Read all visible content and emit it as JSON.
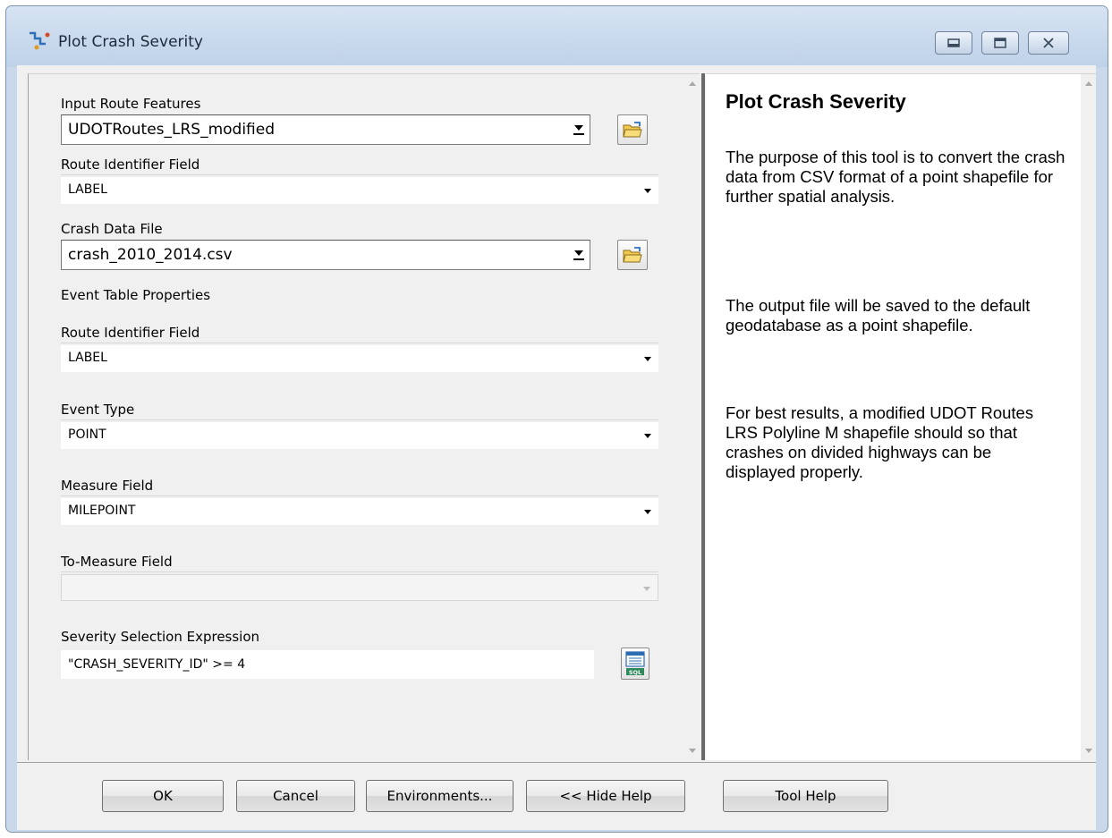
{
  "window": {
    "title": "Plot Crash Severity"
  },
  "form": {
    "input_route_features": {
      "label": "Input Route Features",
      "value": "UDOTRoutes_LRS_modified"
    },
    "route_identifier_field": {
      "label": "Route Identifier Field",
      "value": "LABEL"
    },
    "crash_data_file": {
      "label": "Crash Data File",
      "value": "crash_2010_2014.csv"
    },
    "event_table_properties": {
      "label": "Event Table Properties",
      "route_identifier_field": {
        "label": "Route Identifier Field",
        "value": "LABEL"
      },
      "event_type": {
        "label": "Event Type",
        "value": "POINT"
      },
      "measure_field": {
        "label": "Measure Field",
        "value": "MILEPOINT"
      },
      "to_measure_field": {
        "label": "To-Measure Field",
        "value": ""
      }
    },
    "severity_selection_expression": {
      "label": "Severity Selection Expression",
      "value": "\"CRASH_SEVERITY_ID\" >= 4",
      "sql_button_text": "SQL"
    }
  },
  "help": {
    "title": "Plot Crash Severity",
    "paragraphs": [
      "The purpose of this tool is to convert the crash data from CSV format of a point shapefile for further spatial analysis.",
      "The output file will be saved to the default geodatabase as a point shapefile.",
      "For best results, a modified UDOT Routes LRS Polyline M shapefile should so that crashes on divided highways can be displayed properly."
    ]
  },
  "buttons": {
    "ok": "OK",
    "cancel": "Cancel",
    "environments": "Environments...",
    "hide_help": "<< Hide Help",
    "tool_help": "Tool Help"
  },
  "colors": {
    "titlebar": "#c9d8ea",
    "dialog_bg": "#f0f0f0",
    "help_bg": "#ffffff",
    "folder_icon": "#f2c94c"
  }
}
